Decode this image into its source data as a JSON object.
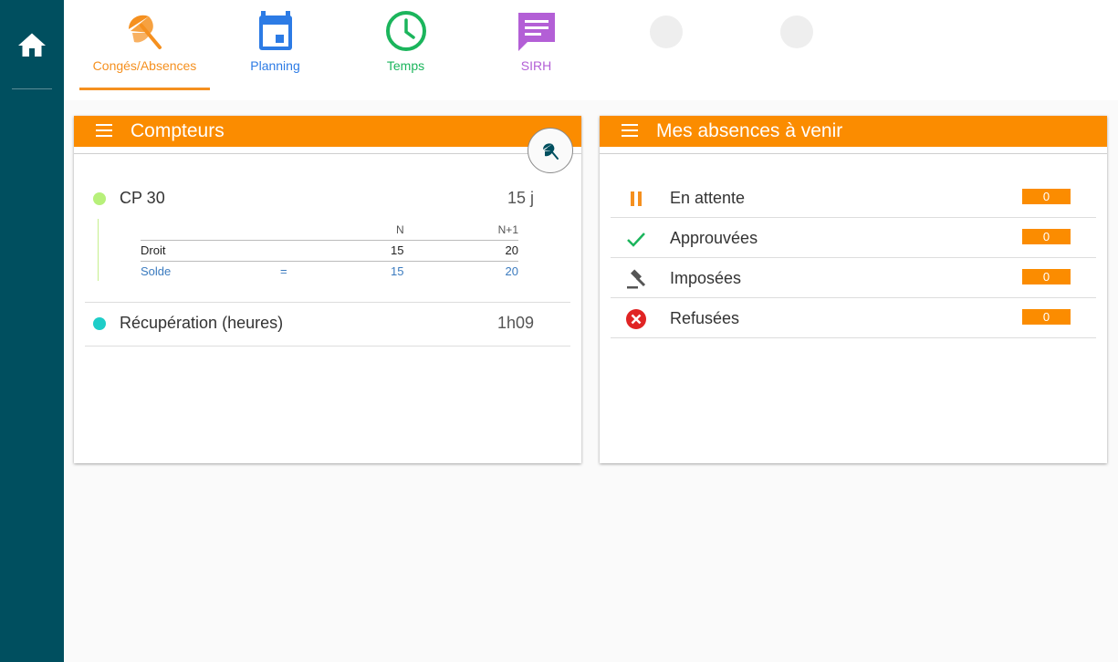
{
  "nav": {
    "items": [
      {
        "label": "Congés/Absences",
        "color": "#f5901f",
        "icon": "beach-umbrella-icon",
        "active": true
      },
      {
        "label": "Planning",
        "color": "#2c7be5",
        "icon": "calendar-icon"
      },
      {
        "label": "Temps",
        "color": "#1bb55c",
        "icon": "clock-icon"
      },
      {
        "label": "SIRH",
        "color": "#b35fd6",
        "icon": "message-icon"
      }
    ]
  },
  "sidebar": {
    "home_icon": "home-icon",
    "bg_color": "#004f5f"
  },
  "counters_card": {
    "title": "Compteurs",
    "header_color": "#fb8c00",
    "cp": {
      "name": "CP 30",
      "value": "15 j",
      "dot_color": "#b7f07a",
      "col_n": "N",
      "col_n1": "N+1",
      "droit_label": "Droit",
      "droit_n": "15",
      "droit_n1": "20",
      "solde_label": "Solde",
      "solde_eq": "=",
      "solde_n": "15",
      "solde_n1": "20",
      "solde_color": "#3b7bbf"
    },
    "recup": {
      "name": "Récupération (heures)",
      "value": "1h09",
      "dot_color": "#1ecdc8"
    }
  },
  "absences_card": {
    "title": "Mes absences à venir",
    "rows": [
      {
        "label": "En attente",
        "count": "0",
        "icon": "pause-icon"
      },
      {
        "label": "Approuvées",
        "count": "0",
        "icon": "check-icon"
      },
      {
        "label": "Imposées",
        "count": "0",
        "icon": "gavel-icon"
      },
      {
        "label": "Refusées",
        "count": "0",
        "icon": "cancel-icon"
      }
    ]
  }
}
